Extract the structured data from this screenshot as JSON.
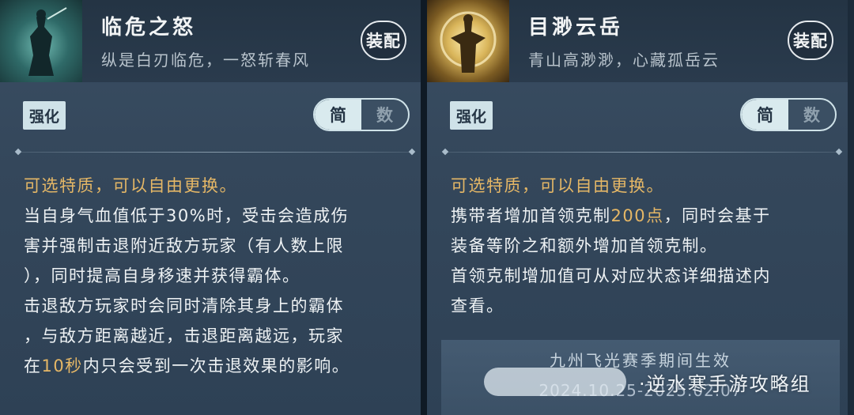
{
  "left": {
    "name": "临危之怒",
    "subtitle": "纵是白刃临危，一怒斩春风",
    "equip_label": "装配",
    "tag": "强化",
    "toggle": [
      "简",
      "数"
    ],
    "lines": [
      {
        "parts": [
          {
            "t": "可选特质，可以自由更换。",
            "gold": true
          }
        ]
      },
      {
        "parts": [
          {
            "t": "当自身气血值低于30%时，受击会造成伤"
          }
        ]
      },
      {
        "parts": [
          {
            "t": "害并强制击退附近敌方玩家（有人数上限"
          }
        ]
      },
      {
        "parts": [
          {
            "t": "），同时提高自身移速并获得霸体。"
          }
        ]
      },
      {
        "parts": [
          {
            "t": "击退敌方玩家时会同时清除其身上的霸体"
          }
        ]
      },
      {
        "parts": [
          {
            "t": "，与敌方距离越近，击退距离越远，玩家"
          }
        ]
      },
      {
        "parts": [
          {
            "t": "在"
          },
          {
            "t": "10秒",
            "gold": true
          },
          {
            "t": "内只会受到一次击退效果的影响。"
          }
        ]
      }
    ]
  },
  "right": {
    "name": "目渺云岳",
    "subtitle": "青山高渺渺，心藏孤岳云",
    "equip_label": "装配",
    "tag": "强化",
    "toggle": [
      "简",
      "数"
    ],
    "lines": [
      {
        "parts": [
          {
            "t": "可选特质，可以自由更换。",
            "gold": true
          }
        ]
      },
      {
        "parts": [
          {
            "t": "携带者增加首领克制"
          },
          {
            "t": "200点",
            "gold": true
          },
          {
            "t": "，同时会基于"
          }
        ]
      },
      {
        "parts": [
          {
            "t": "装备等阶之和额外增加首领克制。"
          }
        ]
      },
      {
        "parts": [
          {
            "t": "首领克制增加值可从对应状态详细描述内"
          }
        ]
      },
      {
        "parts": [
          {
            "t": "查看。"
          }
        ]
      }
    ],
    "season_title": "九州飞光赛季期间生效",
    "season_date": "2024.10.25-2025.02.07"
  },
  "watermark": "·逆水寒手游攻略组",
  "colors": {
    "gold": "#e5b766",
    "text": "#eef2f4",
    "panel": "#34475b"
  }
}
